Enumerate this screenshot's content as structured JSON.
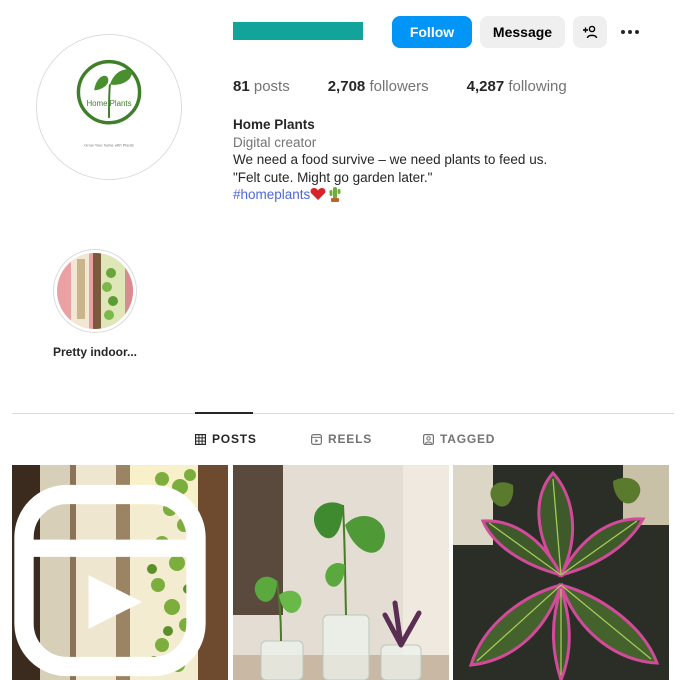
{
  "profile": {
    "actions": {
      "follow_label": "Follow",
      "message_label": "Message",
      "add_user_icon": "add-user-icon",
      "more_icon": "more-options-icon"
    },
    "stats": {
      "posts_count": "81",
      "posts_label": "posts",
      "followers_count": "2,708",
      "followers_label": "followers",
      "following_count": "4,287",
      "following_label": "following"
    },
    "bio": {
      "name": "Home Plants",
      "category": "Digital creator",
      "line1": "We need a food survive – we need plants to feed us.",
      "line2": "\"Felt cute. Might go garden later.\"",
      "hashtag": "#homeplants",
      "emojis": [
        "heart",
        "cactus"
      ]
    },
    "avatar": {
      "logo_text": "Home Plants",
      "tagline": "Grow Your home with Plants"
    }
  },
  "highlights": [
    {
      "label": "Pretty indoor..."
    }
  ],
  "tabs": [
    {
      "label": "POSTS",
      "icon": "grid-icon",
      "active": true
    },
    {
      "label": "REELS",
      "icon": "reels-icon",
      "active": false
    },
    {
      "label": "TAGGED",
      "icon": "tagged-icon",
      "active": false
    }
  ],
  "posts": [
    {
      "subject": "window with hanging vine",
      "is_reel": true
    },
    {
      "subject": "cuttings in glass jars",
      "is_reel": false
    },
    {
      "subject": "pink and green foliage",
      "is_reel": false
    }
  ],
  "colors": {
    "follow_blue": "#0095f6",
    "hashtag_blue": "#4c68d7",
    "username_placeholder": "#12a39a",
    "logo_green": "#3f7f2a"
  }
}
